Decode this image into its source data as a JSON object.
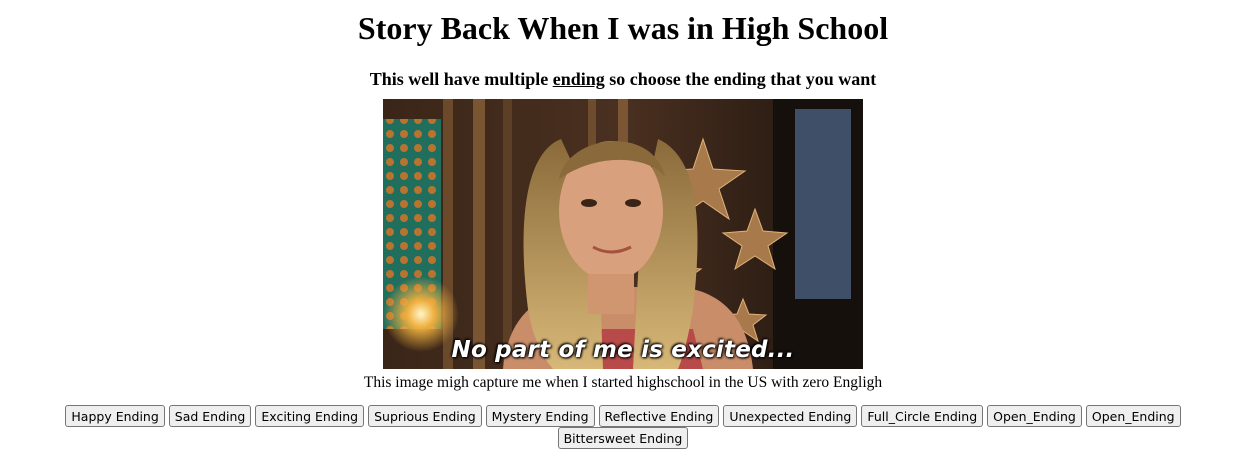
{
  "page": {
    "title": "Story Back When I was in High School",
    "subtitle_before": "This well have multiple ",
    "subtitle_underlined": "ending",
    "subtitle_after": " so choose the ending that you want"
  },
  "image": {
    "overlay_text": "No part of me is excited...",
    "caption": "This image migh capture me when I started highschool in the US with zero Engligh"
  },
  "buttons": [
    {
      "label": "Happy Ending"
    },
    {
      "label": "Sad Ending"
    },
    {
      "label": "Exciting Ending"
    },
    {
      "label": "Suprious Ending"
    },
    {
      "label": "Mystery Ending"
    },
    {
      "label": "Reflective Ending"
    },
    {
      "label": "Unexpected Ending"
    },
    {
      "label": "Full_Circle Ending"
    },
    {
      "label": "Open_Ending"
    },
    {
      "label": "Open_Ending"
    },
    {
      "label": "Bittersweet Ending"
    }
  ]
}
